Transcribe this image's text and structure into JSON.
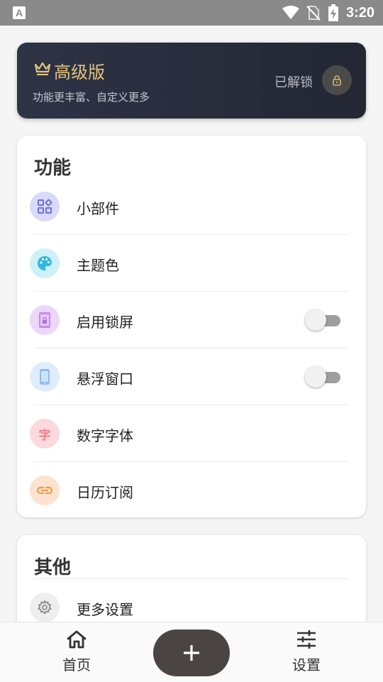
{
  "status_bar": {
    "time": "3:20",
    "left_icon": "A"
  },
  "premium": {
    "title": "高级版",
    "subtitle": "功能更丰富、自定义更多",
    "status": "已解锁",
    "accent_color": "#e3c27d"
  },
  "features": {
    "title": "功能",
    "items": [
      {
        "label": "小部件",
        "icon": "widgets-icon",
        "icon_bg": "#d9d9fb",
        "icon_color": "#6f6fe0"
      },
      {
        "label": "主题色",
        "icon": "palette-icon",
        "icon_bg": "#cdf0f9",
        "icon_color": "#2db9e0"
      },
      {
        "label": "启用锁屏",
        "icon": "phone-lock-icon",
        "icon_bg": "#ecd6fa",
        "icon_color": "#b36ae8",
        "toggle": false
      },
      {
        "label": "悬浮窗口",
        "icon": "phone-icon",
        "icon_bg": "#e0ecfb",
        "icon_color": "#6ba6ec",
        "toggle": false
      },
      {
        "label": "数字字体",
        "icon": "font-char-icon",
        "glyph": "字",
        "icon_bg": "#fbd9dc",
        "icon_color": "#ef7d8a"
      },
      {
        "label": "日历订阅",
        "icon": "link-icon",
        "icon_bg": "#fde3cf",
        "icon_color": "#f39a4a"
      }
    ]
  },
  "other": {
    "title": "其他",
    "items": [
      {
        "label": "更多设置",
        "icon": "gear-icon",
        "icon_bg": "#eeeeee",
        "icon_color": "#8a8a8a"
      }
    ]
  },
  "bottom_nav": {
    "home_label": "首页",
    "settings_label": "设置"
  }
}
